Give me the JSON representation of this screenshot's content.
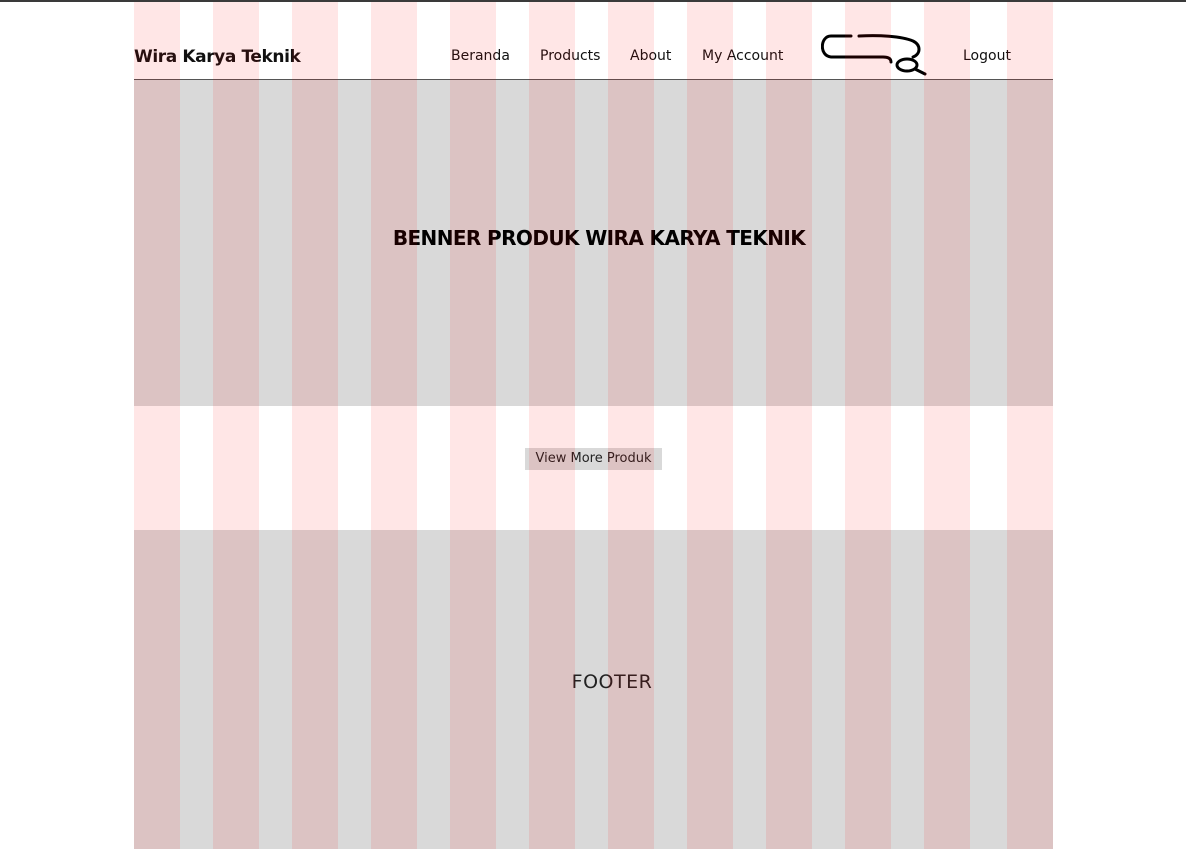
{
  "header": {
    "brand": "Wira Karya Teknik",
    "nav": [
      {
        "label": "Beranda"
      },
      {
        "label": "Products"
      },
      {
        "label": "About"
      },
      {
        "label": "My Account"
      },
      {
        "label": "Logout"
      }
    ],
    "search_icon": "search-icon"
  },
  "banner": {
    "title": "BENNER PRODUK WIRA KARYA TEKNIK"
  },
  "actions": {
    "view_more_label": "View More Produk"
  },
  "footer": {
    "label": "FOOTER"
  },
  "layout_grid": {
    "columns": 12,
    "overlay_color": "#ff000019"
  },
  "colors": {
    "placeholder_gray": "#d9d9d9",
    "text": "#000000",
    "rule": "#555555"
  }
}
